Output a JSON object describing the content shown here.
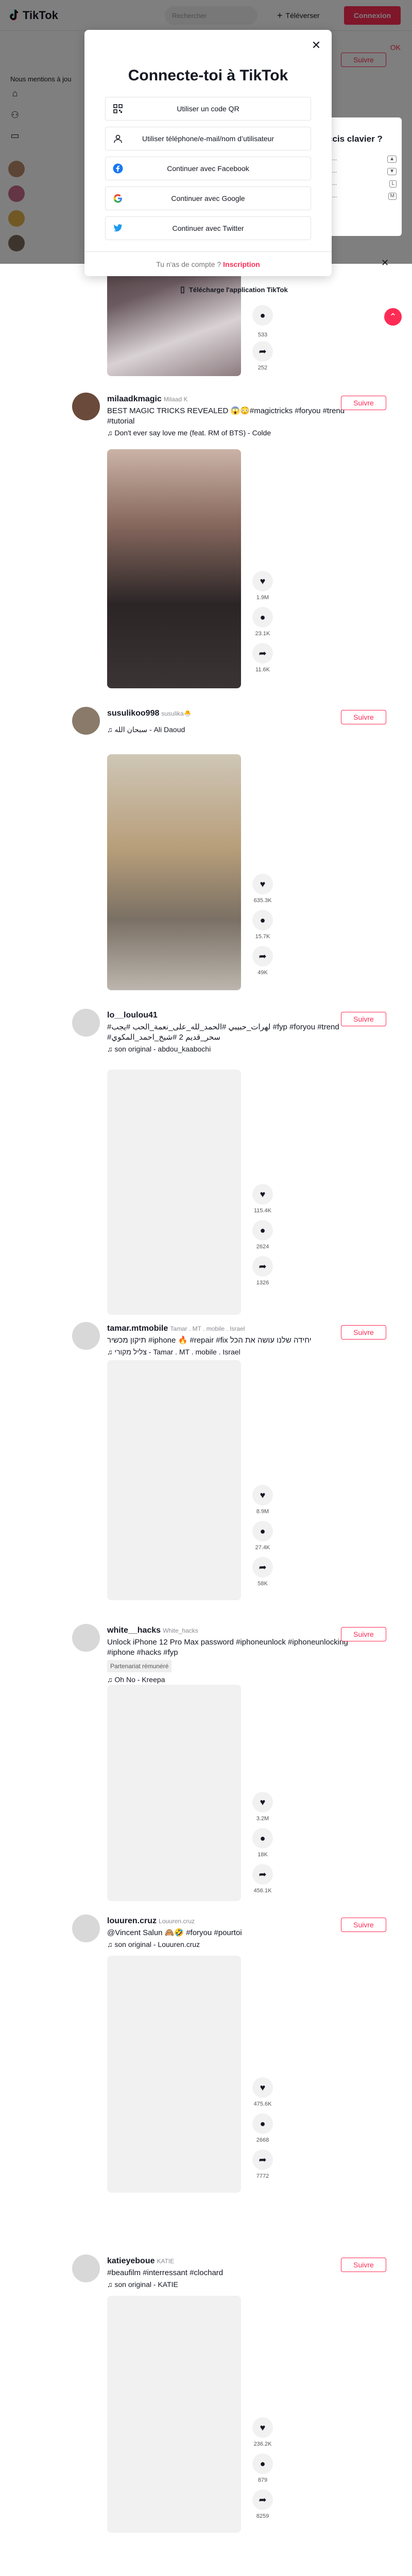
{
  "header": {
    "logo_text": "TikTok",
    "search_placeholder": "Rechercher",
    "upload_label": "Téléverser",
    "login_label": "Connexion"
  },
  "sidebar": {
    "following_label": "Nous mentions à jou",
    "top_ok": "OK"
  },
  "modal": {
    "title": "Connecte-toi à TikTok",
    "options": [
      {
        "label": "Utiliser un code QR",
        "icon": "qr-code-icon"
      },
      {
        "label": "Utiliser téléphone/e-mail/nom d’utilisateur",
        "icon": "person-icon"
      },
      {
        "label": "Continuer avec Facebook",
        "icon": "facebook-icon"
      },
      {
        "label": "Continuer avec Google",
        "icon": "google-icon"
      },
      {
        "label": "Continuer avec Twitter",
        "icon": "twitter-icon"
      }
    ],
    "footer_text": "Tu n'as de compte ?",
    "footer_link": "Inscription"
  },
  "keyboard_popup": {
    "title": "ccis clavier ?"
  },
  "download": {
    "label": "Télécharge l'application TikTok"
  },
  "posts": [
    {
      "user": "",
      "nick": "",
      "desc": "",
      "music": "",
      "follow": "Suivre",
      "counts": [
        "533",
        "",
        "252"
      ]
    },
    {
      "user": "milaadkmagic",
      "nick": "Milaad K",
      "desc": "BEST MAGIC TRICKS REVEALED 😱😳#magictricks #foryou #trend #tutorial",
      "music": "♫ Don't ever say love me (feat. RM of BTS) - Colde",
      "follow": "Suivre",
      "counts": [
        "1.9M",
        "",
        "23.1K",
        "11.6K"
      ]
    },
    {
      "user": "susulikoo998",
      "nick": "susulika🐣",
      "desc": "",
      "music": "♫ سبحان الله - Ali Daoud",
      "follow": "Suivre",
      "counts": [
        "635.3K",
        "",
        "15.7K",
        "49K"
      ]
    },
    {
      "user": "lo__loulou41",
      "nick": "",
      "desc": "#لهرات_حبيبي #الحمد_لله_على_نعمة_الحب #يجب #fyp #foryou #trend #سحر_قديم 2 #شيخ_احمد_المكوي",
      "music": "♫ son original - abdou_kaabochi",
      "follow": "Suivre",
      "counts": [
        "115.4K",
        "",
        "2624",
        "1326"
      ]
    },
    {
      "user": "tamar.mtmobile",
      "nick": "Tamar . MT . mobile . Israel",
      "desc": "תיקון מכשיר #iphone 🔥 #repair #fix יחידה שלנו עושה את הכל",
      "music": "♫ צליל מקורי - Tamar . MT . mobile . Israel",
      "follow": "Suivre",
      "counts": [
        "8.9M",
        "",
        "27.4K",
        "58K"
      ]
    },
    {
      "user": "white__hacks",
      "nick": "White_hacks",
      "desc": "Unlock iPhone 12 Pro Max password #iphoneunlock #iphoneunlocking #iphone #hacks #fyp",
      "sponsored": "Partenariat rémunéré",
      "music": "♫ Oh No - Kreepa",
      "follow": "Suivre",
      "counts": [
        "3.2M",
        "",
        "18K",
        "456.1K"
      ]
    },
    {
      "user": "louuren.cruz",
      "nick": "Louuren.cruz",
      "desc": "@Vincent Salun 🙈🤣 #foryou #pourtoi",
      "music": "♫ son original - Louuren.cruz",
      "follow": "Suivre",
      "counts": [
        "475.6K",
        "",
        "2668",
        "7772"
      ]
    },
    {
      "user": "katieyeboue",
      "nick": "KATIE",
      "desc": "#beaufilm #interressant #clochard",
      "music": "♫ son original - KATIE",
      "follow": "Suivre",
      "counts": [
        "236.2K",
        "",
        "879",
        "8259"
      ]
    }
  ]
}
